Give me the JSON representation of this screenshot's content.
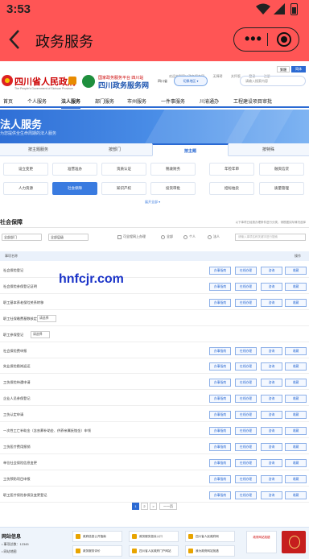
{
  "status_bar": {
    "time": "3:53"
  },
  "app_header": {
    "title": "政务服务",
    "more_label": "•••"
  },
  "site": {
    "top_links": [
      "欢迎来到四川政务服务网",
      "无障碍",
      "关怀版",
      "登录",
      "注册"
    ],
    "lang": [
      "繁體",
      "简体"
    ],
    "gov_name": "四川省人民政府",
    "gov_sub": "The People's Government of Sichuan Province",
    "portal_sub": "国家政务服务平台 四川站",
    "portal_name": "四川政务服务网",
    "region_label": "四川省",
    "region_button": "切换地区 ▾",
    "search_placeholder": "请输入搜索内容"
  },
  "menu": [
    "首页",
    "个人服务",
    "法人服务",
    "部门服务",
    "市州服务",
    "一件事服务",
    "川渝通办",
    "工程建设项目审批"
  ],
  "banner": {
    "title": "法人服务",
    "subtitle": "为您提供全生命周期的法人服务"
  },
  "content_tabs": [
    "按主题服务",
    "按部门",
    "按主题",
    "按特殊"
  ],
  "categories": [
    "设立变更",
    "准营准办",
    "资质认证",
    "税收财务",
    "年检年审",
    "融资信贷",
    "人力资源",
    "社会保障",
    "知识产权",
    "投资审批",
    "招标拍卖",
    "质量管理"
  ],
  "active_category": "社会保障",
  "more_link": "展开全部 ▾",
  "section": {
    "title": "社会保障",
    "note": "以下事项已经按办理条件进行分类，请根据实际情况选择"
  },
  "filters": {
    "sel1": "全部部门",
    "sel2": "全部层级",
    "check1": "可全程网上办理",
    "radio1": "全部",
    "radio2": "个人",
    "radio3": "法人",
    "search_placeholder": "请输入事项名称关键字进行搜索"
  },
  "table_header": {
    "name": "事项名称",
    "actions": "操作"
  },
  "rows": [
    {
      "name": "社会保险登记",
      "buttons": [
        "办事指南",
        "在线办理",
        "咨询",
        "收藏"
      ]
    },
    {
      "name": "社会保险参保登记证明",
      "buttons": [
        "办事指南",
        "在线办理",
        "咨询",
        "收藏"
      ]
    },
    {
      "name": "职工基本养老保险关系转移",
      "buttons": [
        "办事指南",
        "在线办理",
        "咨询",
        "收藏"
      ]
    },
    {
      "name": "职工社保缴费基数核定",
      "select": "请选择",
      "buttons": []
    },
    {
      "name": "职工参保登记",
      "select": "请选择",
      "buttons": []
    },
    {
      "name": "社会保险费申报",
      "buttons": [
        "办事指南",
        "在线办理",
        "咨询",
        "收藏"
      ]
    },
    {
      "name": "失业保险稳岗返还",
      "buttons": [
        "办事指南",
        "在线办理",
        "咨询",
        "收藏"
      ]
    },
    {
      "name": "工伤保险待遇申请",
      "buttons": [
        "办事指南",
        "在线办理",
        "咨询",
        "收藏"
      ]
    },
    {
      "name": "企业人员参保登记",
      "buttons": [
        "办事指南",
        "在线办理",
        "咨询",
        "收藏"
      ]
    },
    {
      "name": "工伤认定申请",
      "buttons": [
        "办事指南",
        "在线办理",
        "咨询",
        "收藏"
      ]
    },
    {
      "name": "一次性工亡补助金（含丧葬补助金、供养亲属抚恤金）申领",
      "buttons": [
        "办事指南",
        "在线办理",
        "咨询",
        "收藏"
      ]
    },
    {
      "name": "工伤医疗费用报销",
      "buttons": [
        "办事指南",
        "在线办理",
        "咨询",
        "收藏"
      ]
    },
    {
      "name": "单位社会保险信息变更",
      "buttons": [
        "办事指南",
        "在线办理",
        "咨询",
        "收藏"
      ]
    },
    {
      "name": "工伤预防项目申报",
      "buttons": [
        "办事指南",
        "在线办理",
        "咨询",
        "收藏"
      ]
    },
    {
      "name": "职工医疗保险参保及变更登记",
      "buttons": [
        "办事指南",
        "在线办理",
        "咨询",
        "收藏"
      ]
    }
  ],
  "pager": {
    "p1": "1",
    "p2": "2",
    "next": ">",
    "last": "一一页"
  },
  "footer": {
    "title": "网站信息",
    "line1": "• 事项总数：12345",
    "line2": "• 网站地图",
    "cards": [
      "政府信息公开指南",
      "政务服务投诉入口",
      "四川省人民政府网",
      "政务服务评价",
      "四川省人民政府门户网站",
      "我为政府网站找错"
    ],
    "qr_label": "政府网站找错"
  },
  "watermark": "hnfcjr.com"
}
